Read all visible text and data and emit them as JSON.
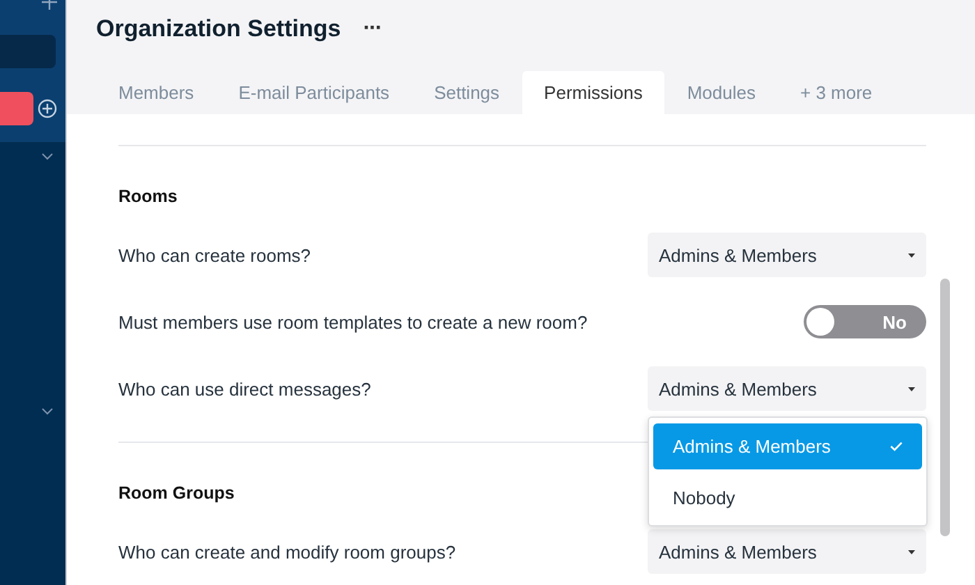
{
  "header": {
    "title": "Organization Settings",
    "menu": "···"
  },
  "tabs": [
    {
      "label": "Members",
      "selected": false
    },
    {
      "label": "E-mail Participants",
      "selected": false
    },
    {
      "label": "Settings",
      "selected": false
    },
    {
      "label": "Permissions",
      "selected": true
    },
    {
      "label": "Modules",
      "selected": false
    },
    {
      "label": "+ 3 more",
      "selected": false
    }
  ],
  "sections": [
    {
      "title": "Rooms",
      "settings": [
        {
          "kind": "select",
          "label": "Who can create rooms?",
          "value": "Admins & Members"
        },
        {
          "kind": "toggle",
          "label": "Must members use room templates to create a new room?",
          "on": false,
          "value": "No"
        },
        {
          "kind": "select",
          "label": "Who can use direct messages?",
          "value": "Admins & Members",
          "options": [
            {
              "label": "Admins & Members",
              "selected": true
            },
            {
              "label": "Nobody",
              "selected": false
            }
          ]
        }
      ]
    },
    {
      "title": "Room Groups",
      "settings": [
        {
          "kind": "select",
          "label": "Who can create and modify room groups?",
          "value": "Admins & Members"
        }
      ]
    }
  ]
}
